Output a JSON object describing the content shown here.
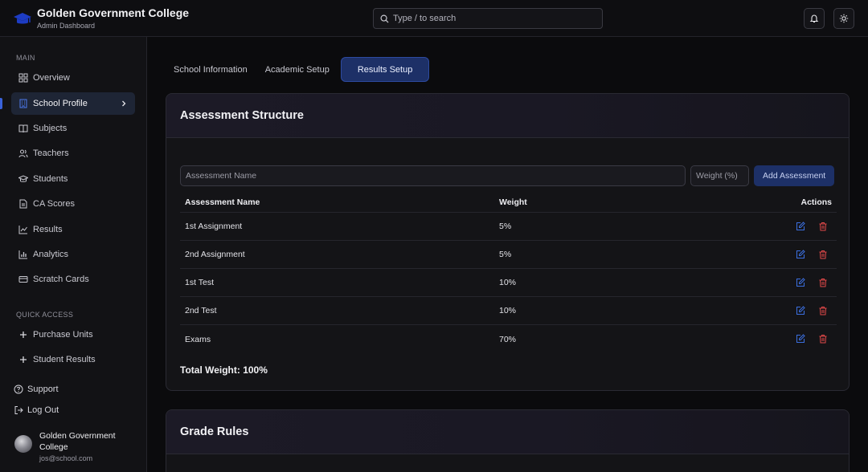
{
  "app": {
    "title": "Golden Government College",
    "subtitle": "Admin Dashboard"
  },
  "search": {
    "placeholder": "Type / to search"
  },
  "sidebar": {
    "main_label": "MAIN",
    "items": [
      {
        "label": "Overview",
        "icon": "grid-icon"
      },
      {
        "label": "School Profile",
        "icon": "building-icon",
        "active": true
      },
      {
        "label": "Subjects",
        "icon": "book-icon"
      },
      {
        "label": "Teachers",
        "icon": "users-icon"
      },
      {
        "label": "Students",
        "icon": "graduation-cap-icon"
      },
      {
        "label": "CA Scores",
        "icon": "document-icon"
      },
      {
        "label": "Results",
        "icon": "line-chart-icon"
      },
      {
        "label": "Analytics",
        "icon": "bar-chart-icon"
      },
      {
        "label": "Scratch Cards",
        "icon": "card-icon"
      }
    ],
    "quick_label": "QUICK ACCESS",
    "quick_items": [
      {
        "label": "Purchase Units"
      },
      {
        "label": "Student Results"
      }
    ],
    "support": "Support",
    "logout": "Log Out",
    "user": {
      "name": "Golden Government College",
      "email": "jos@school.com"
    }
  },
  "tabs": [
    {
      "label": "School Information"
    },
    {
      "label": "Academic Setup"
    },
    {
      "label": "Results Setup",
      "active": true
    }
  ],
  "assessment": {
    "title": "Assessment Structure",
    "name_placeholder": "Assessment Name",
    "weight_placeholder": "Weight (%)",
    "add_label": "Add Assessment",
    "columns": [
      "Assessment Name",
      "Weight",
      "Actions"
    ],
    "rows": [
      {
        "name": "1st Assignment",
        "weight": "5%"
      },
      {
        "name": "2nd Assignment",
        "weight": "5%"
      },
      {
        "name": "1st Test",
        "weight": "10%"
      },
      {
        "name": "2nd Test",
        "weight": "10%"
      },
      {
        "name": "Exams",
        "weight": "70%"
      }
    ],
    "total": "Total Weight: 100%"
  },
  "grade_rules": {
    "title": "Grade Rules"
  },
  "colors": {
    "accent": "#1d3067",
    "edit": "#3b6fe0",
    "delete": "#e04848"
  }
}
